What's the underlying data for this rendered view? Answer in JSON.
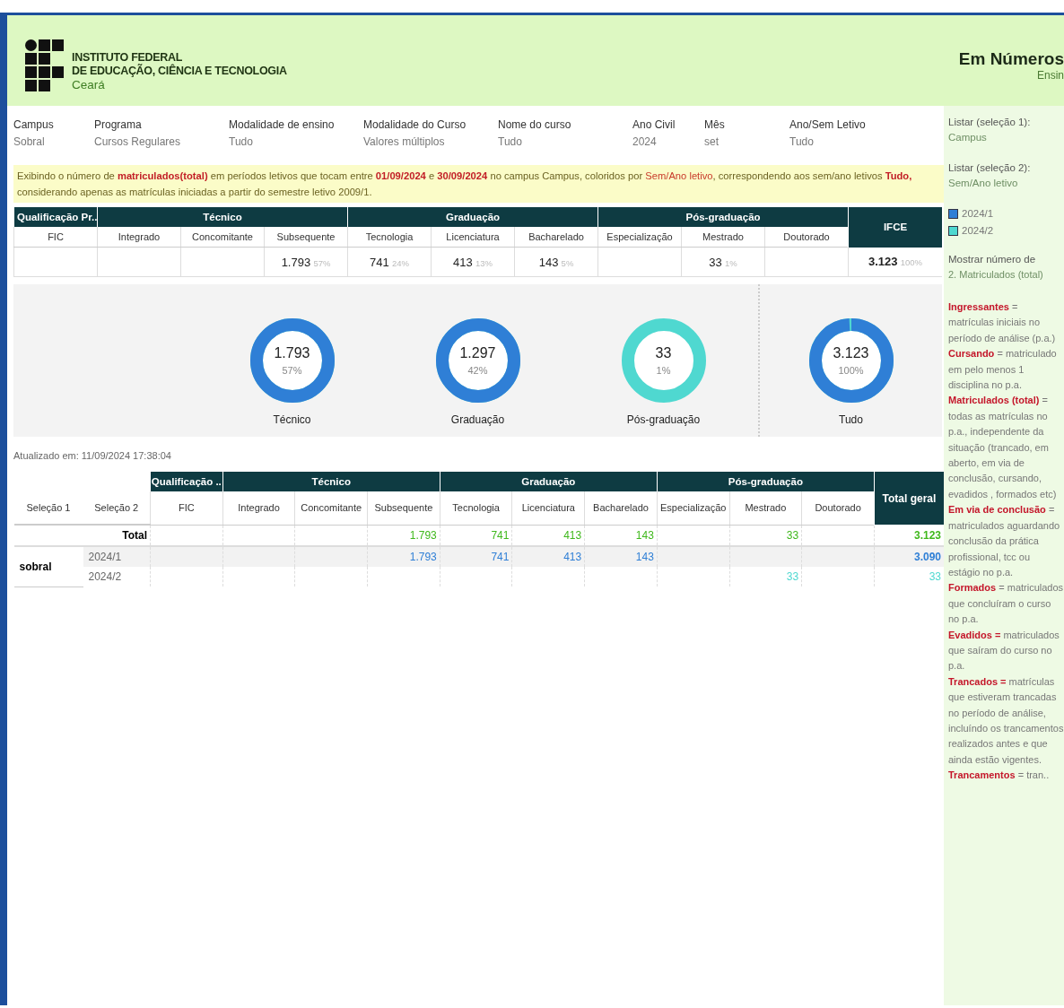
{
  "header": {
    "logo_lines": [
      "INSTITUTO FEDERAL",
      "DE EDUCAÇÃO, CIÊNCIA E TECNOLOGIA"
    ],
    "logo_sub": "Ceará",
    "title": "Em Números",
    "subtitle": "Ensin"
  },
  "filters": [
    {
      "label": "Campus",
      "value": "Sobral"
    },
    {
      "label": "Programa",
      "value": "Cursos Regulares"
    },
    {
      "label": "Modalidade de ensino",
      "value": "Tudo"
    },
    {
      "label": "Modalidade do Curso",
      "value": "Valores múltiplos"
    },
    {
      "label": "Nome do curso",
      "value": "Tudo"
    },
    {
      "label": "Ano Civil",
      "value": "2024"
    },
    {
      "label": "Mês",
      "value": "set"
    },
    {
      "label": "Ano/Sem Letivo",
      "value": "Tudo"
    }
  ],
  "notice": "Exibindo o número de **matriculados(total)** em períodos letivos que tocam entre **01/09/2024** e  **30/09/2024** no campus Campus, coloridos por *Sem/Ano letivo*, correspondendo aos sem/ano letivos **Tudo,** considerando apenas as matrículas iniciadas a partir do semestre letivo 2009/1.",
  "summary_table": {
    "groups": [
      "Qualificação Pr..",
      "Técnico",
      "Graduação",
      "Pós-graduação"
    ],
    "columns": [
      {
        "label": "FIC"
      },
      {
        "label": "Integrado"
      },
      {
        "label": "Concomitante"
      },
      {
        "label": "Subsequente",
        "value": "1.793",
        "pct": "57%"
      },
      {
        "label": "Tecnologia",
        "value": "741",
        "pct": "24%"
      },
      {
        "label": "Licenciatura",
        "value": "413",
        "pct": "13%"
      },
      {
        "label": "Bacharelado",
        "value": "143",
        "pct": "5%"
      },
      {
        "label": "Especialização"
      },
      {
        "label": "Mestrado",
        "value": "33",
        "pct": "1%"
      },
      {
        "label": "Doutorado"
      }
    ],
    "total_header": "IFCE",
    "total": {
      "value": "3.123",
      "pct": "100%"
    }
  },
  "donuts": [
    {
      "value": "1.793",
      "pct": "57%",
      "label": "Técnico",
      "kind": "first"
    },
    {
      "value": "1.297",
      "pct": "42%",
      "label": "Graduação",
      "kind": "first"
    },
    {
      "value": "33",
      "pct": "1%",
      "label": "Pós-graduação",
      "kind": "second"
    },
    {
      "value": "3.123",
      "pct": "100%",
      "label": "Tudo",
      "kind": "mixed"
    }
  ],
  "updated": "Atualizado em: 11/09/2024 17:38:04",
  "detail_table": {
    "row_headers": [
      "Seleção 1",
      "Seleção 2"
    ],
    "groups": [
      "Qualificação ..",
      "Técnico",
      "Graduação",
      "Pós-graduação"
    ],
    "columns": [
      {
        "label": "FIC"
      },
      {
        "label": "Integrado"
      },
      {
        "label": "Concomitante"
      },
      {
        "label": "Subsequente",
        "total": "1.793",
        "first": "1.793"
      },
      {
        "label": "Tecnologia",
        "total": "741",
        "first": "741"
      },
      {
        "label": "Licenciatura",
        "total": "413",
        "first": "413"
      },
      {
        "label": "Bacharelado",
        "total": "143",
        "first": "143"
      },
      {
        "label": "Especialização"
      },
      {
        "label": "Mestrado",
        "total": "33",
        "second": "33"
      },
      {
        "label": "Doutorado"
      }
    ],
    "total_header": "Total geral",
    "rows": [
      {
        "kind": "total",
        "label": "Total",
        "color": "#3fb81c",
        "total": "3.123"
      },
      {
        "kind": "semester",
        "group": "sobral",
        "label": "2024/1",
        "color": "#2f7fd6",
        "total": "3.090"
      },
      {
        "kind": "semester",
        "label": "2024/2",
        "color": "#4fd8d0",
        "total": "33"
      }
    ]
  },
  "sidebar": {
    "selectors": [
      {
        "label": "Listar (seleção 1):",
        "value": "Campus"
      },
      {
        "label": "Listar (seleção 2):",
        "value": "Sem/Ano letivo"
      }
    ],
    "legend": [
      {
        "label": "2024/1",
        "color": "#2f7fd6"
      },
      {
        "label": "2024/2",
        "color": "#4fd8d0"
      }
    ],
    "measure": {
      "label": "Mostrar número de",
      "value": "2. Matriculados (total)"
    },
    "glossary": [
      "**Ingressantes** = matrículas iniciais no período de análise (p.a.)",
      "**Cursando** = matriculado em pelo menos 1 disciplina no p.a.",
      "**Matriculados (total)** = todas as matrículas no p.a., independente da situação (trancado, em aberto, em via de conclusão, cursando, evadidos , formados etc)",
      "**Em via de conclusão** = matriculados aguardando conclusão da prática profissional, tcc ou estágio no p.a.",
      "**Formados** = matriculados que concluíram o curso no p.a.",
      "**Evadidos =** matriculados  que saíram do curso no p.a.",
      "**Trancados =**  matrículas que estiveram trancadas no período de análise, incluíndo os trancamentos realizados antes  e que ainda estão vigentes.",
      "**Trancamentos** = tran.."
    ]
  }
}
